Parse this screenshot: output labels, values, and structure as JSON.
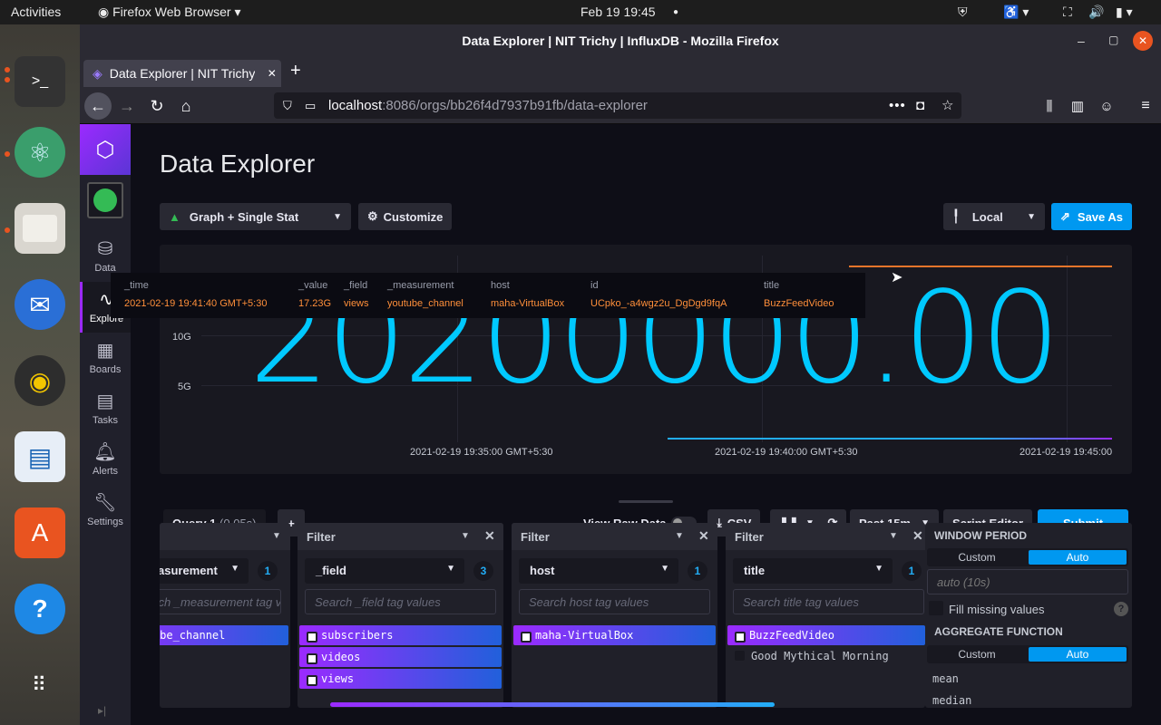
{
  "os": {
    "activities": "Activities",
    "app_menu": "Firefox Web Browser",
    "clock": "Feb 19  19:45"
  },
  "dock": [
    "terminal-icon",
    "atom-icon",
    "files-icon",
    "thunderbird-icon",
    "rhythmbox-icon",
    "writer-icon",
    "software-icon",
    "help-icon",
    "apps-grid-icon"
  ],
  "window": {
    "title": "Data Explorer | NIT Trichy | InfluxDB - Mozilla Firefox",
    "tab": "Data Explorer | NIT Trichy",
    "url_host": "localhost",
    "url_path": ":8086/orgs/bb26f4d7937b91fb/data-explorer"
  },
  "nav": {
    "items": [
      "Data",
      "Explore",
      "Boards",
      "Tasks",
      "Alerts",
      "Settings"
    ]
  },
  "page": {
    "title": "Data Explorer",
    "vis_type": "Graph + Single Stat",
    "customize": "Customize",
    "timezone": "Local",
    "save_as": "Save As"
  },
  "graph": {
    "big_value": "20200000.00",
    "y_ticks": [
      "10G",
      "5G"
    ],
    "x_ticks": [
      "2021-02-19 19:35:00 GMT+5:30",
      "2021-02-19 19:40:00 GMT+5:30",
      "2021-02-19 19:45:00"
    ]
  },
  "tooltip": {
    "headers": [
      "_time",
      "_value",
      "_field",
      "_measurement",
      "host",
      "id",
      "title"
    ],
    "values": [
      "2021-02-19 19:41:40 GMT+5:30",
      "17.23G",
      "views",
      "youtube_channel",
      "maha-VirtualBox",
      "UCpko_-a4wgz2u_DgDgd9fqA",
      "BuzzFeedVideo"
    ]
  },
  "query": {
    "tab": "Query 1",
    "time": "(0.05s)",
    "raw": "View Raw Data",
    "csv": "CSV",
    "range": "Past 15m",
    "script": "Script Editor",
    "submit": "Submit"
  },
  "builder": {
    "card0": {
      "key": "_measurement",
      "count": "1",
      "search": "Search _measurement tag values",
      "items": [
        "youtube_channel"
      ]
    },
    "card1": {
      "head": "Filter",
      "key": "_field",
      "count": "3",
      "search": "Search _field tag values",
      "items": [
        "subscribers",
        "videos",
        "views"
      ]
    },
    "card2": {
      "head": "Filter",
      "key": "host",
      "count": "1",
      "search": "Search host tag values",
      "items": [
        "maha-VirtualBox"
      ]
    },
    "card3": {
      "head": "Filter",
      "key": "title",
      "count": "1",
      "search": "Search title tag values",
      "items": [
        "BuzzFeedVideo"
      ],
      "unselected": "Good Mythical Morning"
    }
  },
  "agg": {
    "window": "WINDOW PERIOD",
    "custom": "Custom",
    "auto": "Auto",
    "auto_val": "auto (10s)",
    "fill": "Fill missing values",
    "agg": "AGGREGATE FUNCTION",
    "funcs": [
      "mean",
      "median"
    ]
  }
}
